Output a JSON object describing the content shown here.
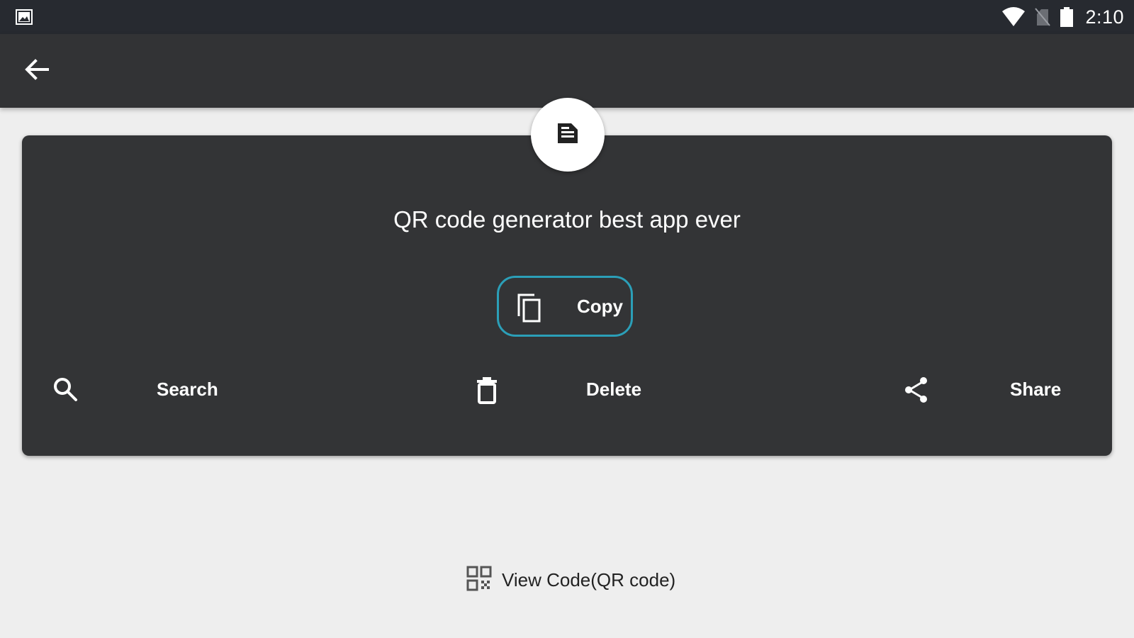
{
  "status_bar": {
    "notification_icon": "image-icon",
    "wifi_icon": "wifi-icon",
    "signal_icon": "no-signal-icon",
    "battery_icon": "battery-icon",
    "time": "2:10"
  },
  "app_bar": {
    "back_icon": "arrow-back-icon"
  },
  "result": {
    "type_icon": "text-document-icon",
    "text": "QR code generator best app ever",
    "copy_label": "Copy",
    "accent_color": "#2b9fb8"
  },
  "actions": [
    {
      "icon": "search-icon",
      "label": "Search"
    },
    {
      "icon": "delete-icon",
      "label": "Delete"
    },
    {
      "icon": "share-icon",
      "label": "Share"
    }
  ],
  "view_code": {
    "icon": "qr-code-icon",
    "label": "View Code(QR code)"
  }
}
